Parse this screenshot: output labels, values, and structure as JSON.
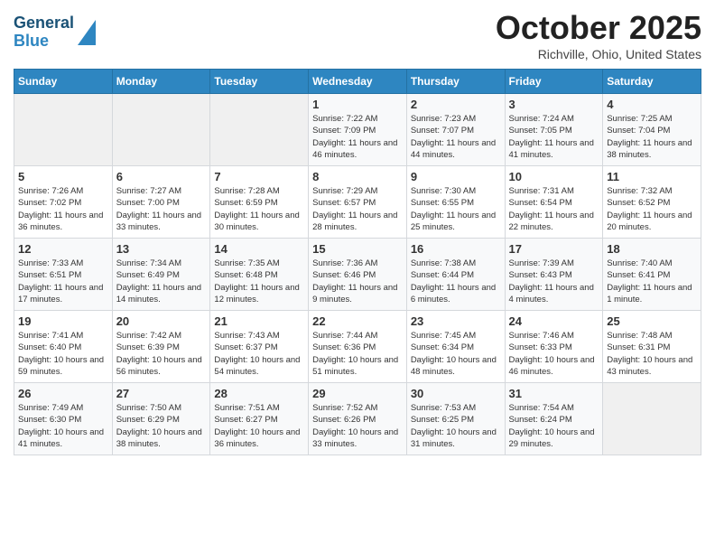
{
  "header": {
    "logo_line1": "General",
    "logo_line2": "Blue",
    "month": "October 2025",
    "location": "Richville, Ohio, United States"
  },
  "days_of_week": [
    "Sunday",
    "Monday",
    "Tuesday",
    "Wednesday",
    "Thursday",
    "Friday",
    "Saturday"
  ],
  "weeks": [
    [
      {
        "day": null
      },
      {
        "day": null
      },
      {
        "day": null
      },
      {
        "day": "1",
        "sunrise": "7:22 AM",
        "sunset": "7:09 PM",
        "daylight": "11 hours and 46 minutes."
      },
      {
        "day": "2",
        "sunrise": "7:23 AM",
        "sunset": "7:07 PM",
        "daylight": "11 hours and 44 minutes."
      },
      {
        "day": "3",
        "sunrise": "7:24 AM",
        "sunset": "7:05 PM",
        "daylight": "11 hours and 41 minutes."
      },
      {
        "day": "4",
        "sunrise": "7:25 AM",
        "sunset": "7:04 PM",
        "daylight": "11 hours and 38 minutes."
      }
    ],
    [
      {
        "day": "5",
        "sunrise": "7:26 AM",
        "sunset": "7:02 PM",
        "daylight": "11 hours and 36 minutes."
      },
      {
        "day": "6",
        "sunrise": "7:27 AM",
        "sunset": "7:00 PM",
        "daylight": "11 hours and 33 minutes."
      },
      {
        "day": "7",
        "sunrise": "7:28 AM",
        "sunset": "6:59 PM",
        "daylight": "11 hours and 30 minutes."
      },
      {
        "day": "8",
        "sunrise": "7:29 AM",
        "sunset": "6:57 PM",
        "daylight": "11 hours and 28 minutes."
      },
      {
        "day": "9",
        "sunrise": "7:30 AM",
        "sunset": "6:55 PM",
        "daylight": "11 hours and 25 minutes."
      },
      {
        "day": "10",
        "sunrise": "7:31 AM",
        "sunset": "6:54 PM",
        "daylight": "11 hours and 22 minutes."
      },
      {
        "day": "11",
        "sunrise": "7:32 AM",
        "sunset": "6:52 PM",
        "daylight": "11 hours and 20 minutes."
      }
    ],
    [
      {
        "day": "12",
        "sunrise": "7:33 AM",
        "sunset": "6:51 PM",
        "daylight": "11 hours and 17 minutes."
      },
      {
        "day": "13",
        "sunrise": "7:34 AM",
        "sunset": "6:49 PM",
        "daylight": "11 hours and 14 minutes."
      },
      {
        "day": "14",
        "sunrise": "7:35 AM",
        "sunset": "6:48 PM",
        "daylight": "11 hours and 12 minutes."
      },
      {
        "day": "15",
        "sunrise": "7:36 AM",
        "sunset": "6:46 PM",
        "daylight": "11 hours and 9 minutes."
      },
      {
        "day": "16",
        "sunrise": "7:38 AM",
        "sunset": "6:44 PM",
        "daylight": "11 hours and 6 minutes."
      },
      {
        "day": "17",
        "sunrise": "7:39 AM",
        "sunset": "6:43 PM",
        "daylight": "11 hours and 4 minutes."
      },
      {
        "day": "18",
        "sunrise": "7:40 AM",
        "sunset": "6:41 PM",
        "daylight": "11 hours and 1 minute."
      }
    ],
    [
      {
        "day": "19",
        "sunrise": "7:41 AM",
        "sunset": "6:40 PM",
        "daylight": "10 hours and 59 minutes."
      },
      {
        "day": "20",
        "sunrise": "7:42 AM",
        "sunset": "6:39 PM",
        "daylight": "10 hours and 56 minutes."
      },
      {
        "day": "21",
        "sunrise": "7:43 AM",
        "sunset": "6:37 PM",
        "daylight": "10 hours and 54 minutes."
      },
      {
        "day": "22",
        "sunrise": "7:44 AM",
        "sunset": "6:36 PM",
        "daylight": "10 hours and 51 minutes."
      },
      {
        "day": "23",
        "sunrise": "7:45 AM",
        "sunset": "6:34 PM",
        "daylight": "10 hours and 48 minutes."
      },
      {
        "day": "24",
        "sunrise": "7:46 AM",
        "sunset": "6:33 PM",
        "daylight": "10 hours and 46 minutes."
      },
      {
        "day": "25",
        "sunrise": "7:48 AM",
        "sunset": "6:31 PM",
        "daylight": "10 hours and 43 minutes."
      }
    ],
    [
      {
        "day": "26",
        "sunrise": "7:49 AM",
        "sunset": "6:30 PM",
        "daylight": "10 hours and 41 minutes."
      },
      {
        "day": "27",
        "sunrise": "7:50 AM",
        "sunset": "6:29 PM",
        "daylight": "10 hours and 38 minutes."
      },
      {
        "day": "28",
        "sunrise": "7:51 AM",
        "sunset": "6:27 PM",
        "daylight": "10 hours and 36 minutes."
      },
      {
        "day": "29",
        "sunrise": "7:52 AM",
        "sunset": "6:26 PM",
        "daylight": "10 hours and 33 minutes."
      },
      {
        "day": "30",
        "sunrise": "7:53 AM",
        "sunset": "6:25 PM",
        "daylight": "10 hours and 31 minutes."
      },
      {
        "day": "31",
        "sunrise": "7:54 AM",
        "sunset": "6:24 PM",
        "daylight": "10 hours and 29 minutes."
      },
      {
        "day": null
      }
    ]
  ],
  "labels": {
    "sunrise": "Sunrise:",
    "sunset": "Sunset:",
    "daylight": "Daylight:"
  }
}
